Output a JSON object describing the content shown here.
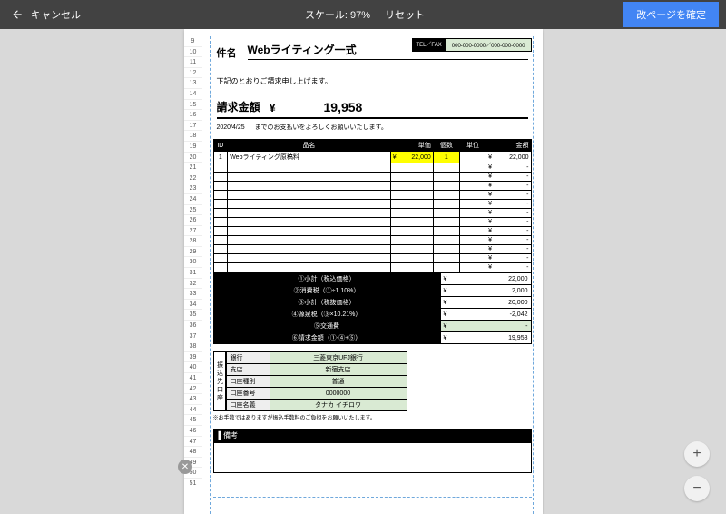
{
  "topbar": {
    "cancel": "キャンセル",
    "scale": "スケール: 97%",
    "reset": "リセット",
    "confirm": "改ページを確定"
  },
  "telfax": {
    "label": "TEL／FAX",
    "value": "000-000-0000／000-000-0000"
  },
  "subject": {
    "label": "件名",
    "value": "Webライティング一式"
  },
  "notice": "下記のとおりご請求申し上げます。",
  "bill": {
    "label": "請求金額",
    "currency": "¥",
    "amount": "19,958"
  },
  "due": {
    "date": "2020/4/25",
    "text": "までのお支払いをよろしくお願いいたします。"
  },
  "columns": {
    "id": "ID",
    "name": "品名",
    "unitprice": "単価",
    "qty": "個数",
    "unit": "単位",
    "amount": "金額"
  },
  "line1": {
    "id": "1",
    "name": "Webライティング原稿料",
    "unitprice": "22,000",
    "qty": "1",
    "amount": "22,000"
  },
  "yen": "¥",
  "dash": "-",
  "totals": {
    "r1": {
      "l": "①小計（税込価格）",
      "v": "22,000"
    },
    "r2": {
      "l": "②消費税（①÷1.10%）",
      "v": "2,000"
    },
    "r3": {
      "l": "③小計（税抜価格）",
      "v": "20,000"
    },
    "r4": {
      "l": "④源泉税（③×10.21%）",
      "v": "-2,042"
    },
    "r5": {
      "l": "⑤交通費",
      "v": "-"
    },
    "r6": {
      "l": "⑥請求金額（①-④+⑤）",
      "v": "19,958"
    }
  },
  "bank": {
    "side": "振込先口座",
    "r1": {
      "h": "銀行",
      "v": "三菱東京UFJ銀行"
    },
    "r2": {
      "h": "支店",
      "v": "新宿支店"
    },
    "r3": {
      "h": "口座種別",
      "v": "普通"
    },
    "r4": {
      "h": "口座番号",
      "v": "0000000"
    },
    "r5": {
      "h": "口座名義",
      "v": "タナカ イチロウ"
    },
    "note": "※お手数ではありますが振込手数料のご負担をお願いいたします。"
  },
  "remark": "備考",
  "rows": [
    "9",
    "10",
    "11",
    "12",
    "13",
    "14",
    "15",
    "16",
    "17",
    "18",
    "19",
    "20",
    "21",
    "22",
    "23",
    "24",
    "25",
    "26",
    "27",
    "28",
    "29",
    "30",
    "31",
    "32",
    "33",
    "34",
    "35",
    "36",
    "37",
    "38",
    "39",
    "40",
    "41",
    "42",
    "43",
    "44",
    "45",
    "46",
    "47",
    "48",
    "49",
    "50",
    "51"
  ]
}
